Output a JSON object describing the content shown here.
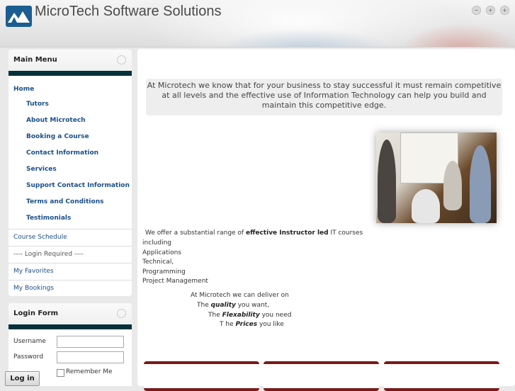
{
  "header": {
    "site_title": "MicroTech Software Solutions",
    "window_controls": [
      "−",
      "+",
      "+"
    ]
  },
  "main_menu": {
    "title": "Main Menu",
    "home": "Home",
    "sub_items": [
      "Tutors",
      "About Microtech",
      "Booking a Course",
      "Contact Information",
      "Services",
      "Support Contact Information",
      "Terms and Conditions",
      "Testimonials"
    ],
    "other_items": [
      "Course Schedule",
      "---- Login Required ----",
      "My Favorites",
      "My Bookings"
    ]
  },
  "login_form": {
    "title": "Login Form",
    "username_label": "Username",
    "password_label": "Password",
    "remember_label": "Remember Me",
    "login_button": "Log in"
  },
  "content": {
    "intro": "At Microtech we know that for your business to stay successful it must remain competitive at all levels and the effective use of Information Technology can help you build and maintain this competitive edge.",
    "offer_prefix": " We offer a substantial range of ",
    "offer_bold": "effective Instructor led",
    "offer_suffix": " IT courses",
    "offer_line2": "including",
    "course_types": [
      "Applications",
      "Technical,",
      "Programming",
      "Project Management"
    ],
    "deliver_line": "At Microtech we can deliver on",
    "quality_pre": "The ",
    "quality_bold": "quality",
    "quality_post": " you want,",
    "flex_pre": "The ",
    "flex_bold": "Flexability",
    "flex_post": " you need",
    "prices_pre": "T he ",
    "prices_bold": "Prices",
    "prices_post": " you like"
  }
}
